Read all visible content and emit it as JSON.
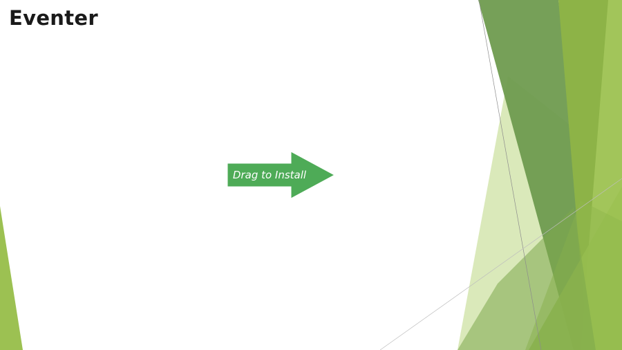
{
  "app": {
    "title": "Eventer"
  },
  "install_arrow": {
    "label": "Drag to Install",
    "icon": "right-arrow-icon",
    "fill_color": "#4eab57"
  },
  "theme": {
    "accent_dark": "#6e9a4e",
    "accent_light": "#a2c55a",
    "background": "#ffffff"
  }
}
